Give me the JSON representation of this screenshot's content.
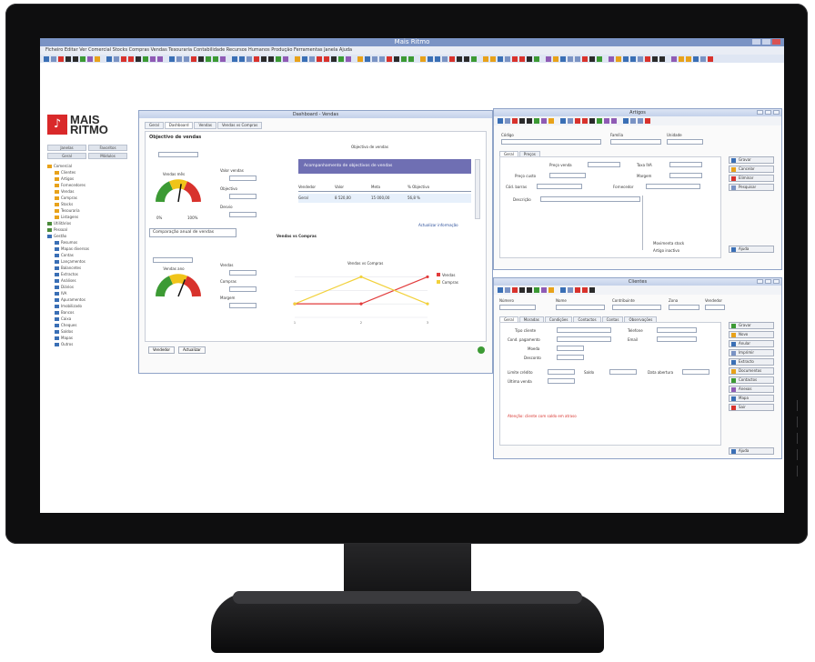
{
  "app": {
    "title": "Mais Ritmo",
    "menu": "Ficheiro   Editar   Ver   Comercial   Stocks   Compras   Vendas   Tesouraria   Contabilidade   Recursos Humanos   Produção   Ferramentas   Janela   Ajuda",
    "accent": "#7a93c4"
  },
  "logo": {
    "line1": "MAIS",
    "line2": "RITMO",
    "mark": "♪",
    "color": "#d9292a"
  },
  "sidebar": {
    "tabs": [
      "Janelas",
      "Favoritos"
    ],
    "subtabs": [
      "Geral",
      "Módulos"
    ],
    "tree": [
      {
        "label": "Comercial",
        "level": 0,
        "color": "#e8a21a"
      },
      {
        "label": "Clientes",
        "level": 1,
        "color": "#e8a21a"
      },
      {
        "label": "Artigos",
        "level": 1,
        "color": "#e8a21a"
      },
      {
        "label": "Fornecedores",
        "level": 1,
        "color": "#e8a21a"
      },
      {
        "label": "Vendas",
        "level": 1,
        "color": "#e8a21a"
      },
      {
        "label": "Compras",
        "level": 1,
        "color": "#e8a21a"
      },
      {
        "label": "Stocks",
        "level": 1,
        "color": "#e8a21a"
      },
      {
        "label": "Tesouraria",
        "level": 1,
        "color": "#e8a21a"
      },
      {
        "label": "Listagens",
        "level": 1,
        "color": "#e8a21a"
      },
      {
        "label": "Utilitários",
        "level": 0,
        "color": "#4a8a3a"
      },
      {
        "label": "Pessoal",
        "level": 0,
        "color": "#4a8a3a"
      },
      {
        "label": "Gestão",
        "level": 0,
        "color": "#3a6fb5"
      },
      {
        "label": "Resumos",
        "level": 1,
        "color": "#3a6fb5"
      },
      {
        "label": "Mapas diversos",
        "level": 1,
        "color": "#3a6fb5"
      },
      {
        "label": "Contas",
        "level": 1,
        "color": "#3a6fb5"
      },
      {
        "label": "Lançamentos",
        "level": 1,
        "color": "#3a6fb5"
      },
      {
        "label": "Balancetes",
        "level": 1,
        "color": "#3a6fb5"
      },
      {
        "label": "Extractos",
        "level": 1,
        "color": "#3a6fb5"
      },
      {
        "label": "Análises",
        "level": 1,
        "color": "#3a6fb5"
      },
      {
        "label": "Diários",
        "level": 1,
        "color": "#3a6fb5"
      },
      {
        "label": "IVA",
        "level": 1,
        "color": "#3a6fb5"
      },
      {
        "label": "Apuramentos",
        "level": 1,
        "color": "#3a6fb5"
      },
      {
        "label": "Imobilizado",
        "level": 1,
        "color": "#3a6fb5"
      },
      {
        "label": "Bancos",
        "level": 1,
        "color": "#3a6fb5"
      },
      {
        "label": "Caixa",
        "level": 1,
        "color": "#3a6fb5"
      },
      {
        "label": "Cheques",
        "level": 1,
        "color": "#3a6fb5"
      },
      {
        "label": "Saldos",
        "level": 1,
        "color": "#3a6fb5"
      },
      {
        "label": "Mapas",
        "level": 1,
        "color": "#3a6fb5"
      },
      {
        "label": "Outros",
        "level": 1,
        "color": "#3a6fb5"
      }
    ]
  },
  "dashboard": {
    "title": "Dashboard - Vendas",
    "tabs": [
      "Geral",
      "Dashboard",
      "Vendas",
      "Vendas vs Compras"
    ],
    "section1_title": "Objectivo de vendas",
    "gauge1_caption": "Vendas mês",
    "gauge1_min": "0%",
    "gauge1_max": "100%",
    "gauge1_value": 0.55,
    "stats1": [
      "Valor vendas",
      "Objectivo",
      "Desvio"
    ],
    "banner": "Acompanhamento de objectivos de vendas",
    "table_headers": [
      "Vendedor",
      "Valor",
      "Meta",
      "% Objectivo"
    ],
    "table_row": [
      "Geral",
      "8 520,00",
      "15 000,00",
      "56,8 %"
    ],
    "footer_link": "Actualizar informação",
    "section2_title": "Comparação anual de vendas",
    "gauge2_caption": "Vendas ano",
    "gauge2_value": 0.62,
    "stats2": [
      "Vendas",
      "Compras",
      "Margem"
    ],
    "chart_title": "Vendas vs Compras",
    "status": [
      "Vendedor",
      "Actualizar"
    ]
  },
  "chart_data": {
    "type": "line",
    "title": "Vendas vs Compras",
    "categories": [
      "1",
      "2",
      "3"
    ],
    "series": [
      {
        "name": "Vendas",
        "color": "#e23b3b",
        "values": [
          1,
          1,
          3
        ]
      },
      {
        "name": "Compras",
        "color": "#f2d13b",
        "values": [
          1,
          3,
          1
        ]
      }
    ],
    "ylim": [
      0,
      3.5
    ],
    "grid": true,
    "legend": "right"
  },
  "artigos_window": {
    "title": "Artigos",
    "labels": [
      "Código",
      "Descrição",
      "Família",
      "Unidade"
    ],
    "tabs": [
      "Geral",
      "Preços",
      "Stocks"
    ],
    "fields": [
      "Preço venda",
      "Preço custo",
      "Margem",
      "Taxa IVA",
      "Cód. barras",
      "Fornecedor"
    ],
    "checks": [
      "Movimenta stock",
      "Artigo inactivo"
    ],
    "buttons": [
      "Gravar",
      "Cancelar",
      "Eliminar",
      "Pesquisar"
    ],
    "side_button": "Ajuda"
  },
  "clientes_window": {
    "title": "Clientes",
    "labels": [
      "Número",
      "Nome",
      "Contribuinte",
      "Zona",
      "Vendedor"
    ],
    "tabs": [
      "Geral",
      "Moradas",
      "Condições",
      "Contactos",
      "Contas",
      "Observações"
    ],
    "fields": [
      "Tipo cliente",
      "Cond. pagamento",
      "Moeda",
      "Desconto",
      "Limite crédito",
      "Saldo",
      "Data abertura",
      "Última venda",
      "Telefone",
      "Email"
    ],
    "warning": "Atenção: cliente com saldo em atraso",
    "buttons": [
      "Gravar",
      "Novo",
      "Anular",
      "Imprimir",
      "Extracto",
      "Documentos",
      "Contactos",
      "Anexos",
      "Mapa",
      "Sair"
    ],
    "side_button": "Ajuda"
  }
}
